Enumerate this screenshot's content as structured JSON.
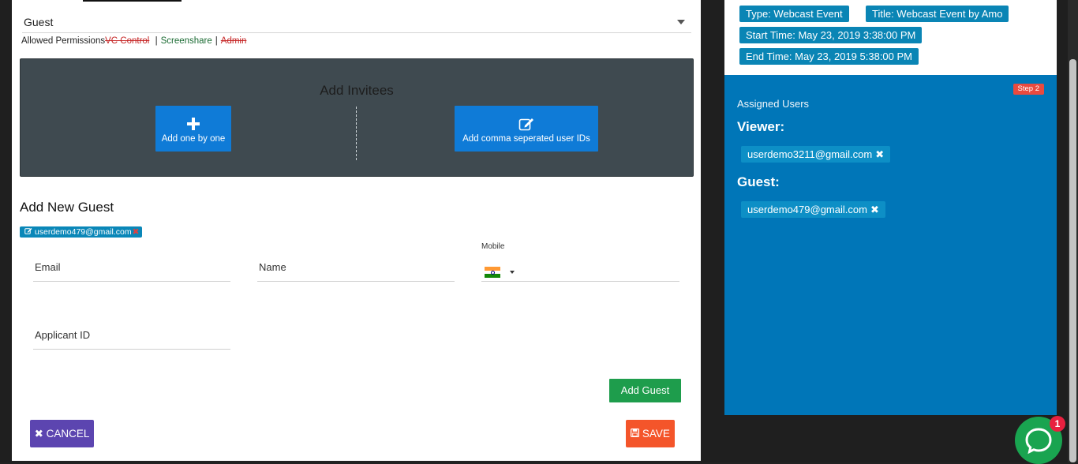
{
  "form": {
    "role_value": "Guest",
    "permissions": {
      "label": "Allowed Permissions",
      "items": [
        {
          "label": "VC Control",
          "state": "disabled"
        },
        {
          "label": "Screenshare",
          "state": "enabled"
        },
        {
          "label": "Admin",
          "state": "disabled"
        }
      ],
      "separator": "|"
    },
    "invitees": {
      "title": "Add Invitees",
      "one_by_one_label": "Add one by one",
      "comma_label": "Add comma seperated user IDs"
    },
    "new_guest": {
      "title": "Add New Guest",
      "chip_email": "userdemo479@gmail.com",
      "email_placeholder": "Email",
      "name_placeholder": "Name",
      "mobile_label": "Mobile",
      "applicant_placeholder": "Applicant ID",
      "add_button": "Add Guest"
    },
    "cancel_button": "CANCEL",
    "save_button": "SAVE",
    "icons": {
      "cancel": "close-icon",
      "save": "floppy-icon",
      "add_one": "plus-icon",
      "comma": "edit-icon",
      "chip": "edit-icon",
      "country_flag": "india-flag-icon"
    }
  },
  "event": {
    "type": "Type: Webcast Event",
    "title": "Title: Webcast Event by Amo",
    "start": "Start Time: May 23, 2019 3:38:00 PM",
    "end": "End Time: May 23, 2019 5:38:00 PM"
  },
  "assigned": {
    "step": "Step 2",
    "heading": "Assigned Users",
    "groups": [
      {
        "name": "Viewer:",
        "users": [
          "userdemo3211@gmail.com"
        ]
      },
      {
        "name": "Guest:",
        "users": [
          "userdemo479@gmail.com"
        ]
      }
    ]
  },
  "chat": {
    "badge_count": "1"
  },
  "colors": {
    "panel_blue": "#0076b8",
    "tag_blue": "#0a85b5",
    "add_guest_green": "#1e9d4c",
    "cancel_purple": "#5c45b0",
    "save_orange": "#f4552a",
    "invitees_bg": "#3f4a50",
    "chat_green": "#19a450"
  }
}
